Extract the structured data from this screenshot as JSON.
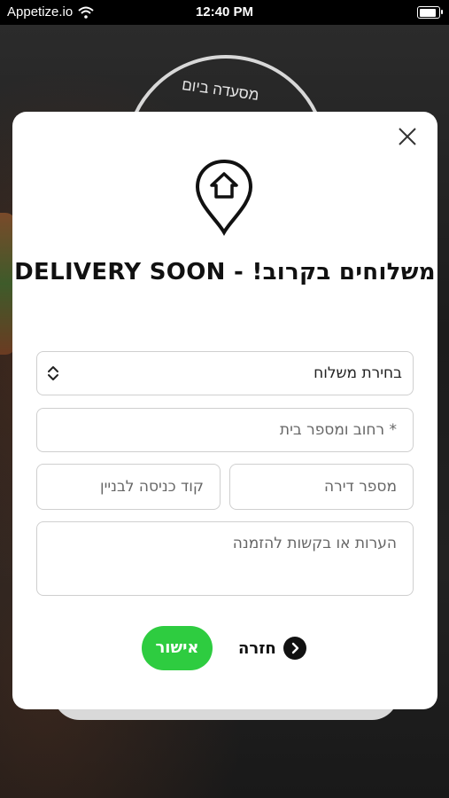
{
  "status_bar": {
    "carrier": "Appetize.io",
    "time": "12:40 PM"
  },
  "background": {
    "logo_text": "מסעדה ביום"
  },
  "modal": {
    "title": "משלוחים בקרוב! - DELIVERY SOON",
    "fields": {
      "delivery_select": "בחירת משלוח",
      "street_placeholder": "* רחוב ומספר בית",
      "apartment_placeholder": "מספר דירה",
      "entry_code_placeholder": "קוד כניסה לבניין",
      "notes_placeholder": "הערות או בקשות להזמנה"
    },
    "buttons": {
      "confirm": "אישור",
      "back": "חזרה"
    }
  },
  "colors": {
    "accent": "#2ecc40",
    "modal_bg": "#ffffff"
  },
  "icons": [
    "wifi-icon",
    "battery-icon",
    "close-icon",
    "location-home-pin-icon",
    "chevron-updown-icon",
    "chevron-right-circle-icon"
  ]
}
